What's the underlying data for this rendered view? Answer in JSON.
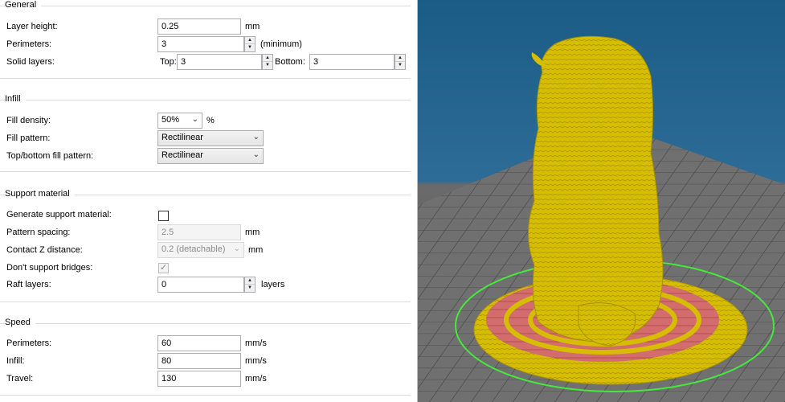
{
  "general": {
    "title": "General",
    "layer_height": {
      "label": "Layer height:",
      "value": "0.25",
      "unit": "mm"
    },
    "perimeters": {
      "label": "Perimeters:",
      "value": "3",
      "unit": "(minimum)"
    },
    "solid_layers": {
      "label": "Solid layers:",
      "top_label": "Top:",
      "top_value": "3",
      "bottom_label": "Bottom:",
      "bottom_value": "3"
    }
  },
  "infill": {
    "title": "Infill",
    "fill_density": {
      "label": "Fill density:",
      "value": "50%",
      "unit": "%"
    },
    "fill_pattern": {
      "label": "Fill pattern:",
      "value": "Rectilinear"
    },
    "top_bottom_pattern": {
      "label": "Top/bottom fill pattern:",
      "value": "Rectilinear"
    }
  },
  "support": {
    "title": "Support material",
    "generate": {
      "label": "Generate support material:",
      "checked": false
    },
    "pattern_spacing": {
      "label": "Pattern spacing:",
      "value": "2.5",
      "unit": "mm"
    },
    "contact_z": {
      "label": "Contact Z distance:",
      "value": "0.2 (detachable)",
      "unit": "mm"
    },
    "dont_support_bridges": {
      "label": "Don't support bridges:",
      "checked": true
    },
    "raft_layers": {
      "label": "Raft layers:",
      "value": "0",
      "unit": "layers"
    }
  },
  "speed": {
    "title": "Speed",
    "perimeters": {
      "label": "Perimeters:",
      "value": "60",
      "unit": "mm/s"
    },
    "infill": {
      "label": "Infill:",
      "value": "80",
      "unit": "mm/s"
    },
    "travel": {
      "label": "Travel:",
      "value": "130",
      "unit": "mm/s"
    }
  },
  "viewport": {
    "background_top": "#1a5e8a",
    "background_bottom": "#5a5a5a",
    "bed_color": "#6d6d6d",
    "grid_color": "#4a4a4a",
    "model_color": "#d8c000",
    "infill_color": "#d46a6a",
    "outline_color": "#46e83c"
  }
}
